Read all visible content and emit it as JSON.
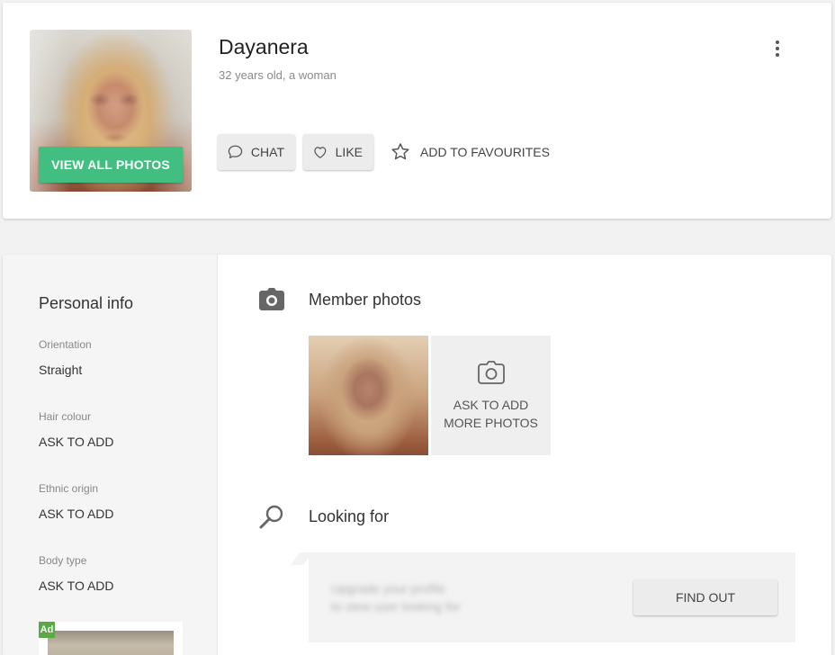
{
  "profile": {
    "name": "Dayanera",
    "subtitle": "32 years old, a woman",
    "view_photos_label": "VIEW ALL PHOTOS"
  },
  "actions": {
    "chat_label": "CHAT",
    "like_label": "LIKE",
    "favourites_label": "ADD TO FAVOURITES"
  },
  "sidebar": {
    "title": "Personal info",
    "items": [
      {
        "label": "Orientation",
        "value": "Straight"
      },
      {
        "label": "Hair colour",
        "value": "ASK TO ADD"
      },
      {
        "label": "Ethnic origin",
        "value": "ASK TO ADD"
      },
      {
        "label": "Body type",
        "value": "ASK TO ADD"
      }
    ],
    "ad_badge": "Ad"
  },
  "photos": {
    "title": "Member photos",
    "ask_more_line1": "ASK TO ADD",
    "ask_more_line2": "MORE PHOTOS"
  },
  "looking_for": {
    "title": "Looking for",
    "blurred_line1": "Upgrade your profile",
    "blurred_line2": "to view user looking for",
    "find_out_label": "FIND OUT"
  },
  "colors": {
    "accent_green": "#3cc07e",
    "ad_green": "#5aa846",
    "background": "#f2f2f2"
  },
  "icons": [
    "more-vertical-icon",
    "chat-bubble-icon",
    "heart-icon",
    "star-icon",
    "camera-icon",
    "search-icon"
  ]
}
